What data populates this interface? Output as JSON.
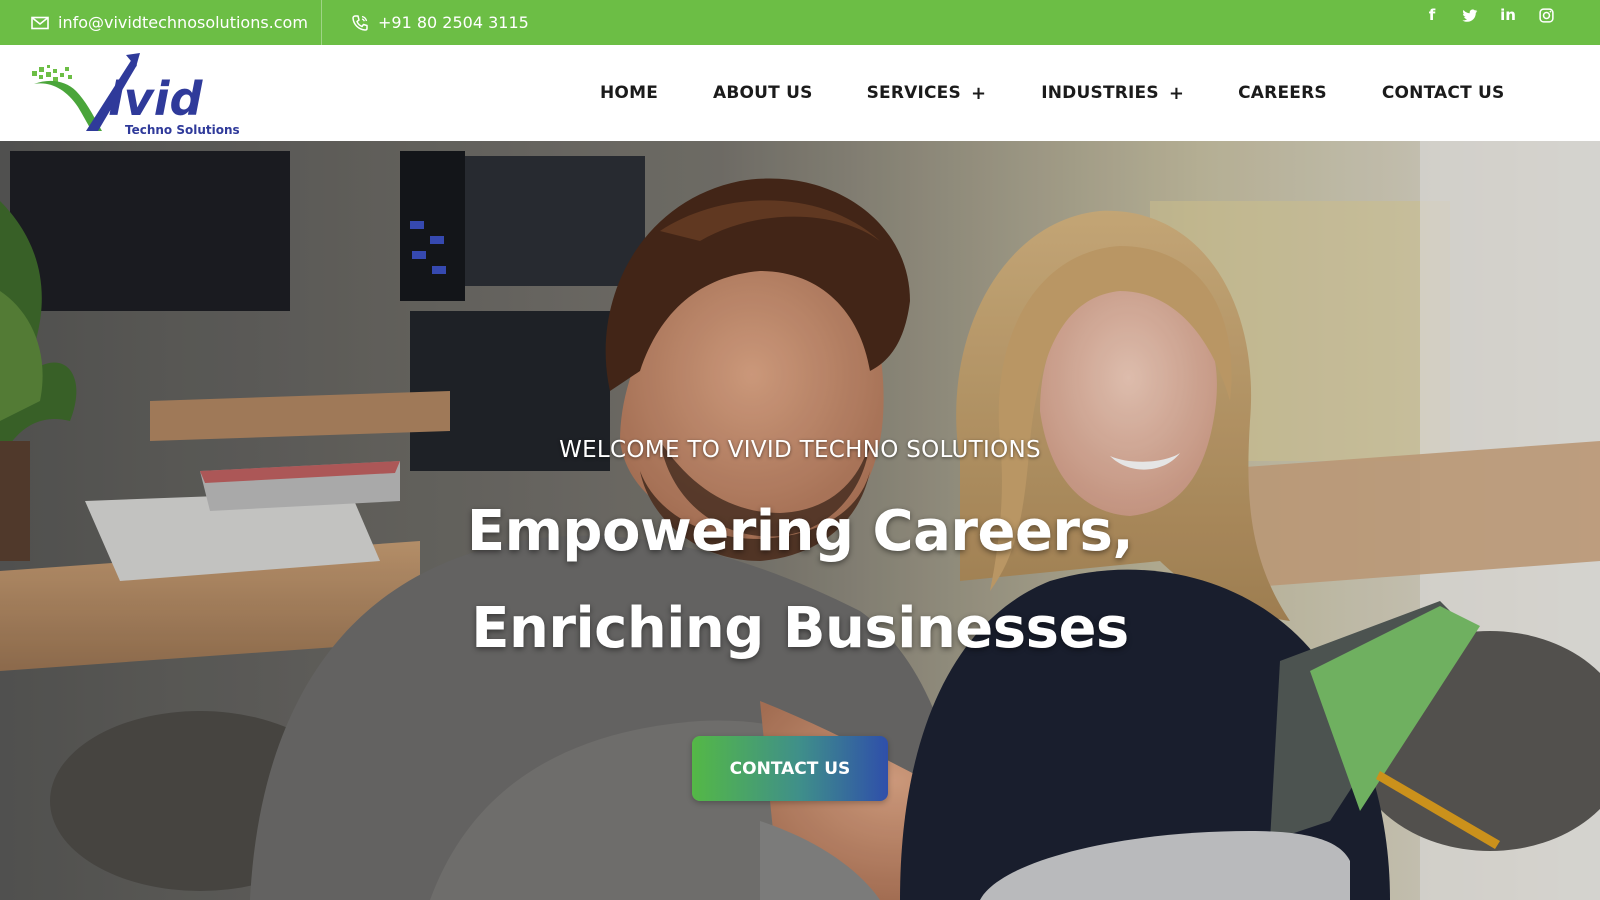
{
  "topbar": {
    "email": "info@vividtechnosolutions.com",
    "phone": "+91 80 2504 3115",
    "social": [
      {
        "icon": "facebook-icon",
        "glyph": "f"
      },
      {
        "icon": "twitter-icon",
        "glyph": ""
      },
      {
        "icon": "linkedin-icon",
        "glyph": "in"
      },
      {
        "icon": "instagram-icon",
        "glyph": ""
      }
    ]
  },
  "header": {
    "logo": {
      "wordmark": "Vivid",
      "tagline": "Techno Solutions"
    },
    "nav": [
      {
        "label": "HOME",
        "has_submenu": false
      },
      {
        "label": "ABOUT US",
        "has_submenu": false
      },
      {
        "label": "SERVICES",
        "has_submenu": true
      },
      {
        "label": "INDUSTRIES",
        "has_submenu": true
      },
      {
        "label": "CAREERS",
        "has_submenu": false
      },
      {
        "label": "CONTACT US",
        "has_submenu": false
      }
    ],
    "submenu_indicator": "+"
  },
  "hero": {
    "welcome": "WELCOME TO VIVID TECHNO SOLUTIONS",
    "headline_line1": "Empowering Careers,",
    "headline_line2": "Enriching Businesses",
    "cta_label": "CONTACT US"
  },
  "colors": {
    "brand_green": "#6cbe45",
    "brand_blue": "#2f4faa",
    "nav_text": "#1b1b1b"
  }
}
